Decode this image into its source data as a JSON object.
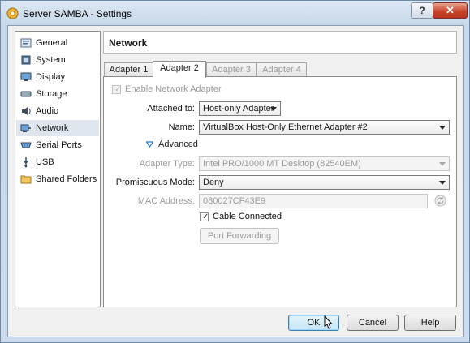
{
  "window": {
    "title": "Server SAMBA - Settings",
    "help": "?",
    "close": "✕"
  },
  "sidebar": {
    "items": [
      {
        "label": "General",
        "icon": "general-icon"
      },
      {
        "label": "System",
        "icon": "system-icon"
      },
      {
        "label": "Display",
        "icon": "display-icon"
      },
      {
        "label": "Storage",
        "icon": "storage-icon"
      },
      {
        "label": "Audio",
        "icon": "audio-icon"
      },
      {
        "label": "Network",
        "icon": "network-icon",
        "selected": true
      },
      {
        "label": "Serial Ports",
        "icon": "serial-ports-icon"
      },
      {
        "label": "USB",
        "icon": "usb-icon"
      },
      {
        "label": "Shared Folders",
        "icon": "shared-folders-icon"
      }
    ]
  },
  "page": {
    "title": "Network"
  },
  "tabs": [
    {
      "label": "Adapter 1",
      "state": "normal"
    },
    {
      "label": "Adapter 2",
      "state": "active"
    },
    {
      "label": "Adapter 3",
      "state": "disabled"
    },
    {
      "label": "Adapter 4",
      "state": "disabled"
    }
  ],
  "adapter": {
    "enable_label": "Enable Network Adapter",
    "enable_checked": true,
    "attached_label": "Attached to:",
    "attached_value": "Host-only Adapter",
    "name_label": "Name:",
    "name_value": "VirtualBox Host-Only Ethernet Adapter #2",
    "advanced_label": "Advanced",
    "adapter_type_label": "Adapter Type:",
    "adapter_type_value": "Intel PRO/1000 MT Desktop (82540EM)",
    "promiscuous_label": "Promiscuous Mode:",
    "promiscuous_value": "Deny",
    "mac_label": "MAC Address:",
    "mac_value": "080027CF43E9",
    "cable_label": "Cable Connected",
    "cable_checked": true,
    "port_forwarding_label": "Port Forwarding"
  },
  "buttons": {
    "ok": "OK",
    "cancel": "Cancel",
    "help": "Help"
  },
  "checkmark": "✓",
  "colors": {
    "accent_blue": "#3c7fb1",
    "close_red": "#c8452c"
  }
}
